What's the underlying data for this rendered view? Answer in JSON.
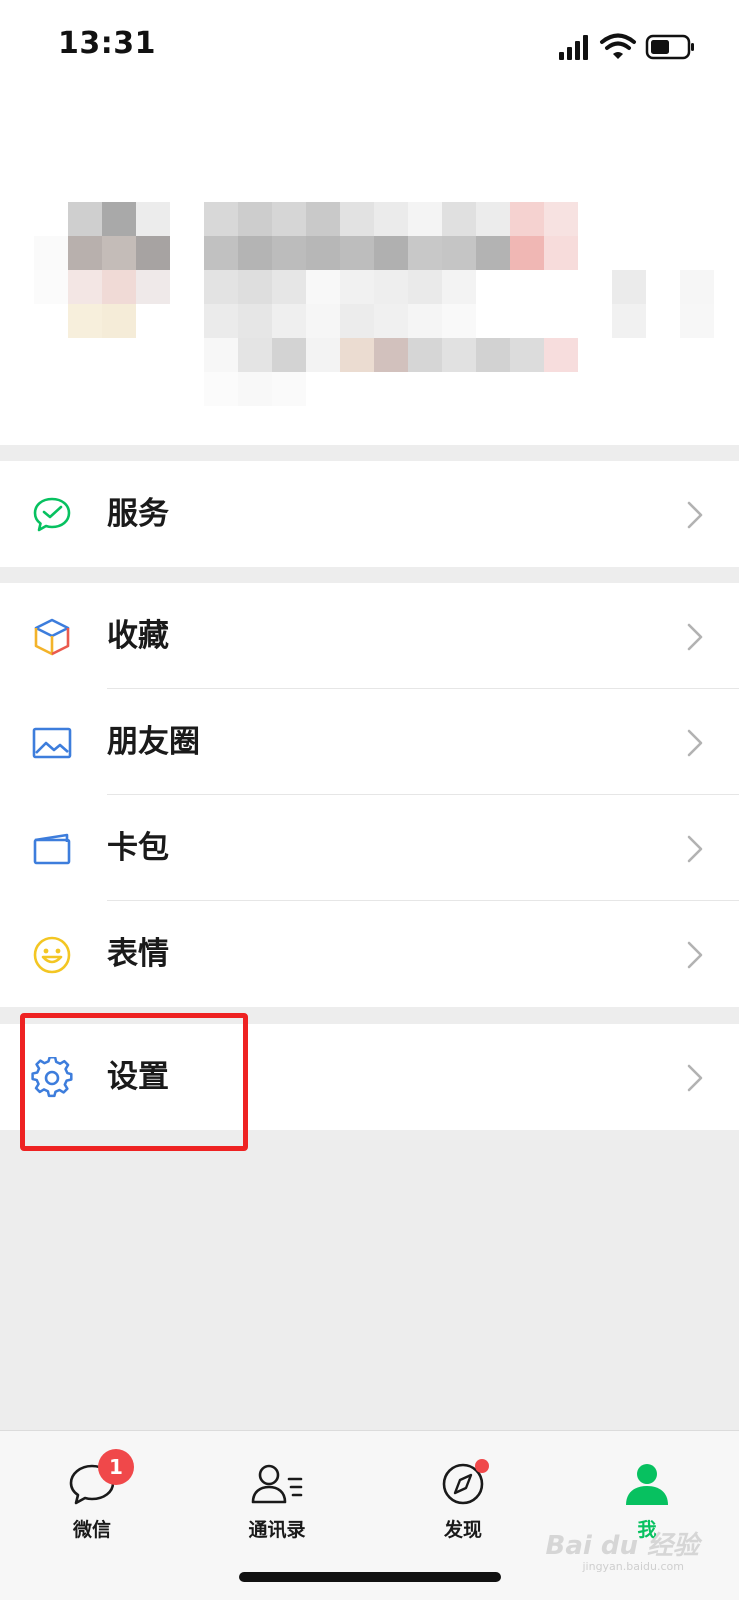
{
  "status_bar": {
    "time": "13:31",
    "icons": [
      "signal-icon",
      "wifi-icon",
      "battery-icon"
    ]
  },
  "profile": {
    "name_blurred": true
  },
  "groups": [
    {
      "rows": [
        {
          "label": "服务",
          "icon": "wechat-pay-icon",
          "color": "#07c160"
        }
      ]
    },
    {
      "rows": [
        {
          "label": "收藏",
          "icon": "favorites-cube-icon",
          "color": "#f3b32a"
        },
        {
          "label": "朋友圈",
          "icon": "moments-picture-icon",
          "color": "#3d7ddc"
        },
        {
          "label": "卡包",
          "icon": "card-wallet-icon",
          "color": "#3d7ddc"
        },
        {
          "label": "表情",
          "icon": "smiley-icon",
          "color": "#f3c623"
        }
      ]
    },
    {
      "rows": [
        {
          "label": "设置",
          "icon": "gear-icon",
          "color": "#3d7ddc"
        }
      ]
    }
  ],
  "tab_bar": {
    "tabs": [
      {
        "label": "微信",
        "icon": "chat-bubble-icon",
        "badge": "1"
      },
      {
        "label": "通讯录",
        "icon": "contacts-icon"
      },
      {
        "label": "发现",
        "icon": "compass-icon",
        "dot": true
      },
      {
        "label": "我",
        "icon": "person-icon",
        "active": true
      }
    ]
  },
  "watermark": {
    "text": "Bai du 经验",
    "sub": "jingyan.baidu.com"
  },
  "colors": {
    "accent": "#07c160",
    "highlight": "#ee2222",
    "badge": "#f0484a"
  }
}
